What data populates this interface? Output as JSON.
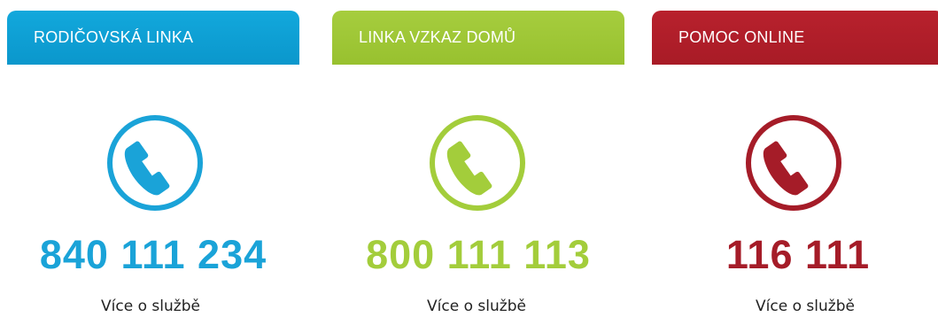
{
  "cards": [
    {
      "title": "RODIČOVSKÁ LINKA",
      "phone": "840 111 234",
      "link": "Více o službě",
      "color": "#1aa3d8",
      "icon": "phone-icon"
    },
    {
      "title": "LINKA VZKAZ DOMŮ",
      "phone": "800 111 113",
      "link": "Více o službě",
      "color": "#a3cd3b",
      "icon": "phone-icon"
    },
    {
      "title": "POMOC ONLINE",
      "phone": "116 111",
      "link": "Více o službě",
      "color": "#a51c28",
      "icon": "phone-icon"
    }
  ]
}
